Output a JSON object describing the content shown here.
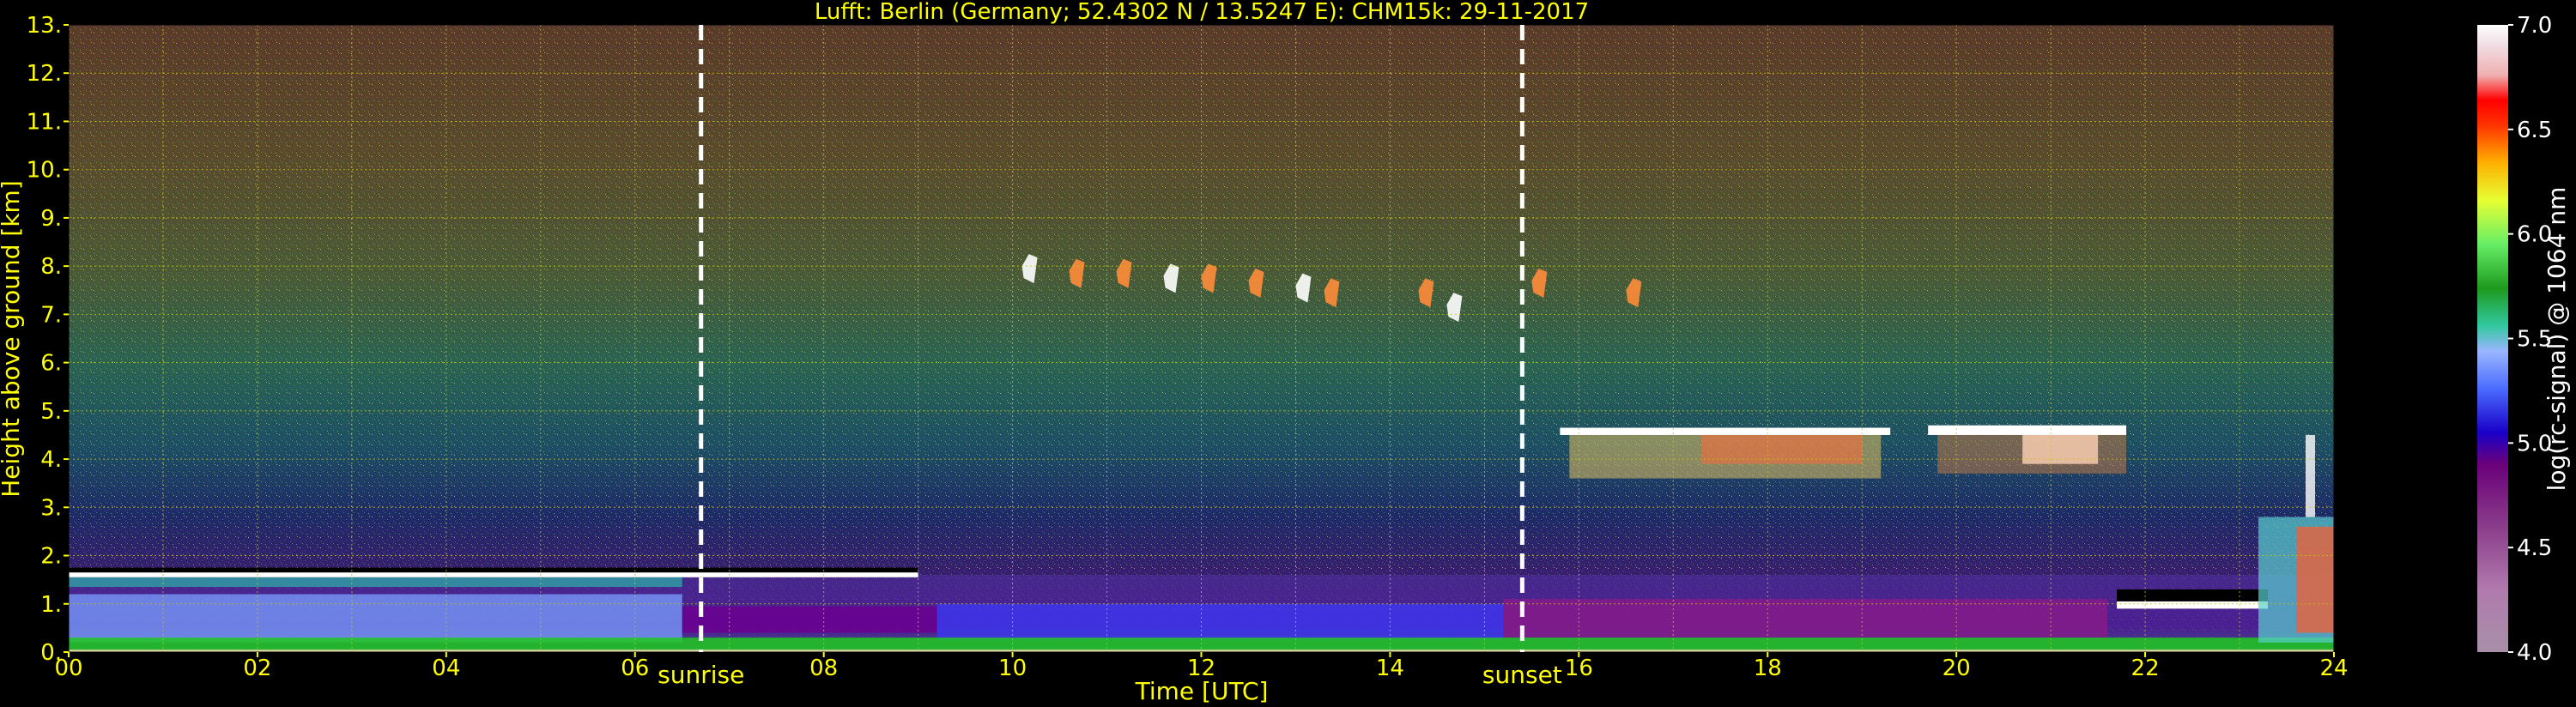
{
  "chart_data": {
    "type": "heatmap",
    "title": "Lufft: Berlin (Germany; 52.4302 N / 13.5247 E):    CHM15k: 29-11-2017",
    "xlabel": "Time [UTC]",
    "ylabel": "Height above ground [km]",
    "xlim": [
      0,
      24
    ],
    "ylim": [
      0,
      13
    ],
    "x_ticks": [
      "00",
      "02",
      "04",
      "06",
      "08",
      "10",
      "12",
      "14",
      "16",
      "18",
      "20",
      "22",
      "24"
    ],
    "y_ticks": [
      "0.",
      "1.",
      "2.",
      "3.",
      "4.",
      "5.",
      "6.",
      "7.",
      "8.",
      "9.",
      "10.",
      "11.",
      "12.",
      "13."
    ],
    "grid": true,
    "colorbar": {
      "label": "log(rc-signal) @ 1064 nm",
      "range": [
        4.0,
        7.0
      ],
      "ticks": [
        "4.0",
        "4.5",
        "5.0",
        "5.5",
        "6.0",
        "6.5",
        "7.0"
      ]
    },
    "markers": [
      {
        "label": "sunrise",
        "time": 6.7
      },
      {
        "label": "sunset",
        "time": 15.4
      }
    ],
    "features": [
      {
        "name": "boundary layer top",
        "time": [
          0,
          9.0
        ],
        "height_km": 1.6
      },
      {
        "name": "cirrus",
        "time": [
          10,
          15
        ],
        "height_km": [
          6.8,
          8.2
        ]
      },
      {
        "name": "cirrus",
        "time": [
          15.5,
          16.7
        ],
        "height_km": [
          7.4,
          7.8
        ]
      },
      {
        "name": "altocumulus",
        "time": [
          15.8,
          21.8
        ],
        "height_km": [
          3.6,
          4.6
        ]
      },
      {
        "name": "low cloud",
        "time": [
          21.6,
          23.2
        ],
        "height_km": [
          0.9,
          1.2
        ]
      },
      {
        "name": "precipitation",
        "time": [
          23.0,
          24
        ],
        "height_km": [
          0.2,
          4.5
        ]
      }
    ]
  },
  "colors": {
    "text": "#ffff00",
    "grid": "#c8c800",
    "marker": "#ffffff"
  }
}
